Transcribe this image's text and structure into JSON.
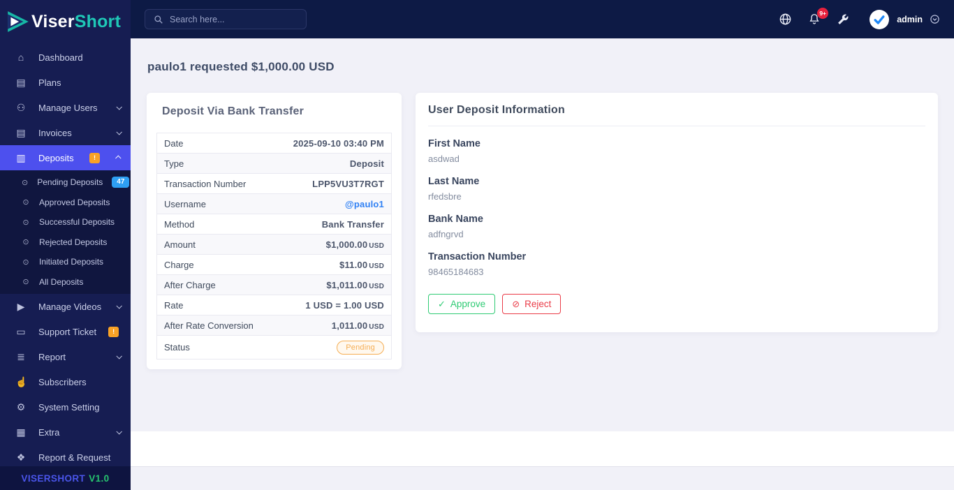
{
  "brand": {
    "name_primary": "Viser",
    "name_secondary": "Short",
    "version_label": "VISERSHORT",
    "version_number": "V1.0"
  },
  "topbar": {
    "search_placeholder": "Search here...",
    "notification_count": "9+",
    "admin_label": "admin"
  },
  "sidebar": {
    "items": [
      {
        "icon": "home",
        "label": "Dashboard"
      },
      {
        "icon": "clipboard",
        "label": "Plans"
      },
      {
        "icon": "users",
        "label": "Manage Users",
        "chevron": "down"
      },
      {
        "icon": "invoice",
        "label": "Invoices",
        "chevron": "down"
      },
      {
        "icon": "deposit",
        "label": "Deposits",
        "badge": "!",
        "chevron": "up",
        "active": true,
        "sub": [
          {
            "label": "Pending Deposits",
            "badge": "47"
          },
          {
            "label": "Approved Deposits"
          },
          {
            "label": "Successful Deposits"
          },
          {
            "label": "Rejected Deposits"
          },
          {
            "label": "Initiated Deposits"
          },
          {
            "label": "All Deposits"
          }
        ]
      },
      {
        "icon": "video",
        "label": "Manage Videos",
        "chevron": "down"
      },
      {
        "icon": "ticket",
        "label": "Support Ticket",
        "badge": "!",
        "chevron": "down"
      },
      {
        "icon": "report",
        "label": "Report",
        "chevron": "down"
      },
      {
        "icon": "thumbs-up",
        "label": "Subscribers"
      },
      {
        "icon": "gear",
        "label": "System Setting"
      },
      {
        "icon": "table",
        "label": "Extra",
        "chevron": "down"
      },
      {
        "icon": "bug",
        "label": "Report & Request"
      }
    ]
  },
  "page": {
    "title": "paulo1 requested $1,000.00 USD"
  },
  "deposit_card": {
    "title": "Deposit Via Bank Transfer",
    "rows": [
      {
        "label": "Date",
        "value": "2025-09-10 03:40 PM"
      },
      {
        "label": "Type",
        "value": "Deposit"
      },
      {
        "label": "Transaction Number",
        "value": "LPP5VU3T7RGT"
      },
      {
        "label": "Username",
        "value": "@paulo1",
        "link": true
      },
      {
        "label": "Method",
        "value": "Bank Transfer"
      },
      {
        "label": "Amount",
        "value": "$1,000.00",
        "suffix": "USD"
      },
      {
        "label": "Charge",
        "value": "$11.00",
        "suffix": "USD"
      },
      {
        "label": "After Charge",
        "value": "$1,011.00",
        "suffix": "USD"
      },
      {
        "label": "Rate",
        "value": "1 USD = 1.00 USD"
      },
      {
        "label": "After Rate Conversion",
        "value": "1,011.00",
        "suffix": "USD"
      },
      {
        "label": "Status",
        "badge": "Pending"
      }
    ]
  },
  "user_card": {
    "title": "User Deposit Information",
    "fields": [
      {
        "label": "First Name",
        "value": "asdwad"
      },
      {
        "label": "Last Name",
        "value": "rfedsbre"
      },
      {
        "label": "Bank Name",
        "value": "adfngrvd"
      },
      {
        "label": "Transaction Number",
        "value": "98465184683"
      }
    ],
    "approve_label": "Approve",
    "reject_label": "Reject"
  },
  "colors": {
    "sidebar_bg": "#161d52",
    "topbar_bg": "#0d1a45",
    "active_item": "#4d50ee",
    "brand_teal": "#1fc8b7",
    "warn_badge": "#f9a226",
    "count_badge": "#2e9ff3",
    "approve_green": "#2fcb74",
    "reject_red": "#ea3b47",
    "pending_orange": "#f5ad53",
    "link_blue": "#2f80f4"
  }
}
